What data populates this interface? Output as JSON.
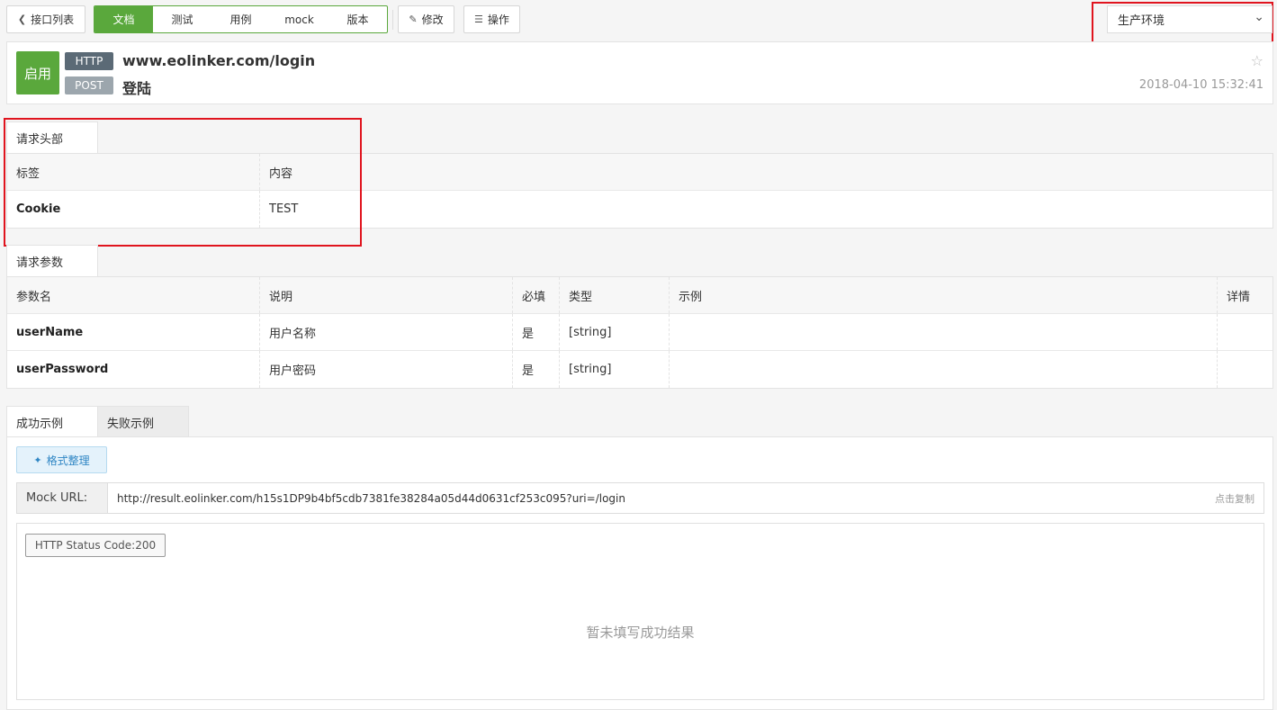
{
  "toolbar": {
    "back_label": "接口列表",
    "tabs": [
      "文档",
      "测试",
      "用例",
      "mock",
      "版本"
    ],
    "edit_label": "修改",
    "operate_label": "操作"
  },
  "environment": {
    "selected": "生产环境"
  },
  "api": {
    "status": "启用",
    "protocol": "HTTP",
    "method": "POST",
    "url": "www.eolinker.com/login",
    "name": "登陆",
    "date": "2018-04-10 15:32:41"
  },
  "request_headers": {
    "tab_label": "请求头部",
    "columns": [
      "标签",
      "内容"
    ],
    "rows": [
      {
        "label": "Cookie",
        "content": "TEST"
      }
    ]
  },
  "request_params": {
    "tab_label": "请求参数",
    "columns": [
      "参数名",
      "说明",
      "必填",
      "类型",
      "示例",
      "详情"
    ],
    "rows": [
      {
        "name": "userName",
        "desc": "用户名称",
        "required": "是",
        "type": "[string]",
        "example": "",
        "detail": ""
      },
      {
        "name": "userPassword",
        "desc": "用户密码",
        "required": "是",
        "type": "[string]",
        "example": "",
        "detail": ""
      }
    ]
  },
  "result": {
    "tabs": [
      "成功示例",
      "失败示例"
    ],
    "format_label": "格式整理",
    "mock_label": "Mock URL:",
    "mock_url": "http://result.eolinker.com/h15s1DP9b4bf5cdb7381fe38284a05d44d0631cf253c095?uri=/login",
    "copy_label": "点击复制",
    "status_code": "HTTP Status Code:200",
    "empty_text": "暂未填写成功结果"
  },
  "colors": {
    "accent": "#5aa83c",
    "highlight": "#e0141e"
  }
}
